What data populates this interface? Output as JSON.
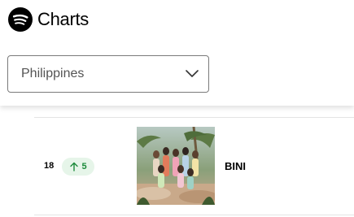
{
  "header": {
    "brand_label": "Charts",
    "logo_icon": "spotify-logo-icon"
  },
  "country_select": {
    "selected": "Philippines",
    "chevron_icon": "chevron-down-icon"
  },
  "chart_list": {
    "rows": [
      {
        "rank": "18",
        "change_direction": "up",
        "change_value": "5",
        "artist": "BINI",
        "artwork_icon": "artist-photo"
      }
    ]
  },
  "colors": {
    "badge_bg": "#e6f5e9",
    "badge_text": "#1b8a3a",
    "border": "#7a7a7a",
    "divider": "#e4e4e4"
  }
}
